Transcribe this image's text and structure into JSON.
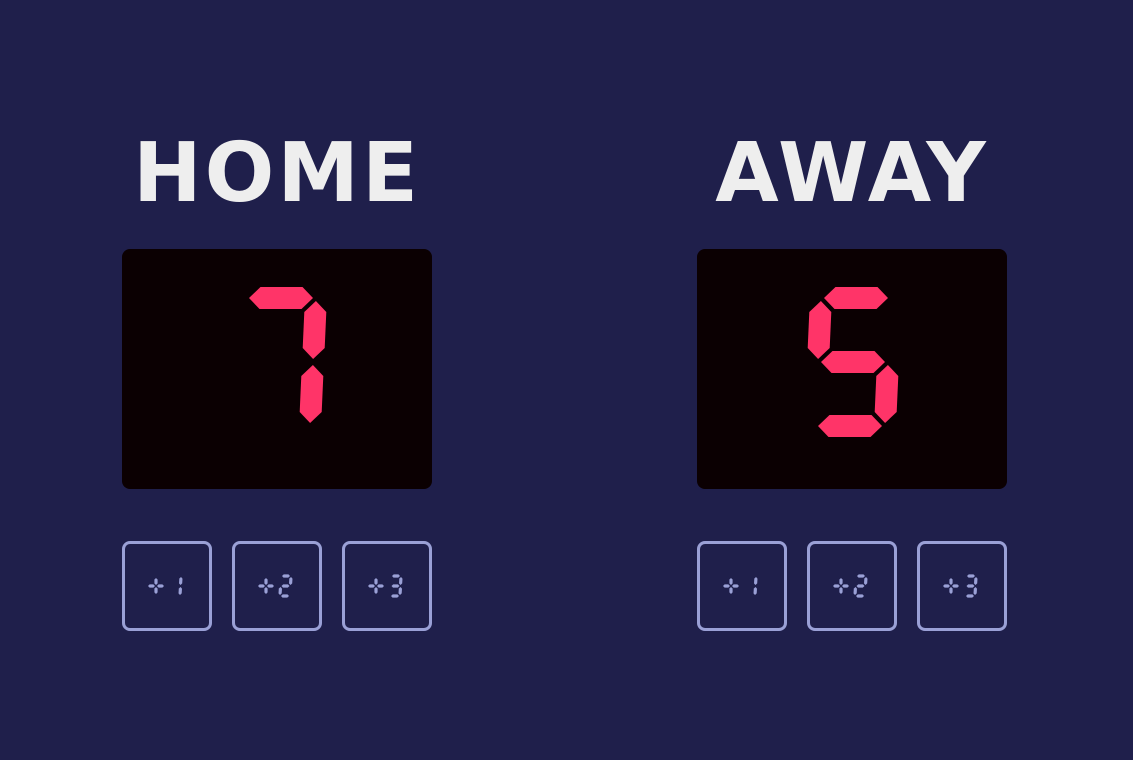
{
  "colors": {
    "background": "#1f1f4b",
    "team_name": "#eeeeee",
    "score_panel": "#0b0002",
    "score_digit": "#ff3468",
    "button_outline": "#9aa0d6"
  },
  "home": {
    "name": "HOME",
    "score": "7",
    "buttons": [
      {
        "label": "+1"
      },
      {
        "label": "+2"
      },
      {
        "label": "+3"
      }
    ]
  },
  "away": {
    "name": "AWAY",
    "score": "5",
    "buttons": [
      {
        "label": "+1"
      },
      {
        "label": "+2"
      },
      {
        "label": "+3"
      }
    ]
  }
}
